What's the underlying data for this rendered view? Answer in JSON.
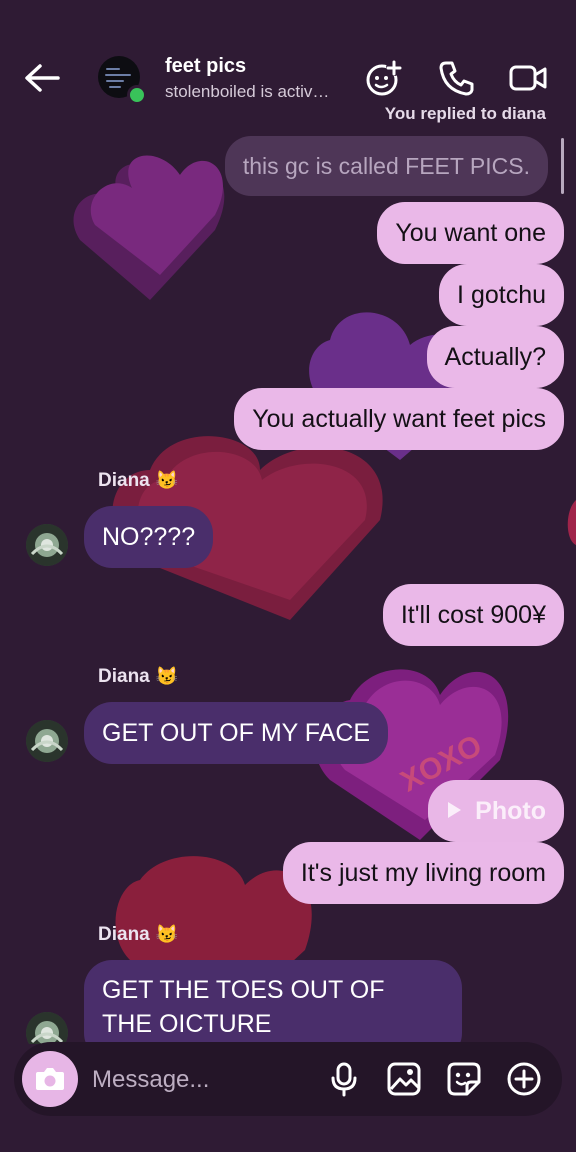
{
  "header": {
    "title": "feet pics",
    "subtitle": "stolenboiled is active now"
  },
  "reply_note": "You replied to diana",
  "messages": {
    "reply_quote": "this gc is called FEET PICS.",
    "m1": "You want one",
    "m2": "I gotchu",
    "m3": "Actually?",
    "m4": "You actually want feet pics",
    "diana1_name": "Diana",
    "diana1_text": "NO????",
    "m5": "It'll cost 900¥",
    "diana2_name": "Diana",
    "diana2_text": "GET OUT OF MY FACE",
    "photo_label": "Photo",
    "m6": "It's  just my living room",
    "diana3_name": "Diana",
    "diana3_text": "GET THE TOES OUT OF THE OICTURE",
    "cat_emoji": "😼"
  },
  "composer": {
    "placeholder": "Message..."
  },
  "icons": [
    "back-arrow-icon",
    "effects-icon",
    "phone-icon",
    "video-icon",
    "camera-icon",
    "microphone-icon",
    "gallery-icon",
    "sticker-icon",
    "plus-icon"
  ],
  "colors": {
    "background": "#2f1b34",
    "my_bubble": "#eab8e8",
    "their_bubble": "#4a2e6b",
    "online": "#39c35a"
  },
  "background_text": "XOXO"
}
